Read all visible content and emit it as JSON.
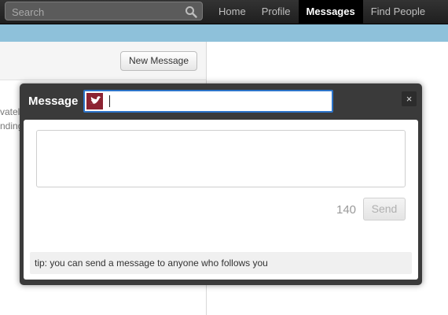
{
  "search": {
    "placeholder": "Search",
    "icon": "magnifier"
  },
  "nav": {
    "items": [
      {
        "label": "Home",
        "active": false
      },
      {
        "label": "Profile",
        "active": false
      },
      {
        "label": "Messages",
        "active": true
      },
      {
        "label": "Find People",
        "active": false
      }
    ]
  },
  "page": {
    "new_message_label": "New Message",
    "partial_line_1": "vately message s",
    "partial_line_2": "nding"
  },
  "modal": {
    "title": "Message",
    "recipient_value": "",
    "message_value": "",
    "char_count": "140",
    "send_label": "Send",
    "close_glyph": "×",
    "tip": "tip: you can send a message to anyone who follows you"
  },
  "colors": {
    "topbar": "#222222",
    "accent_bar": "#8ec1da",
    "modal_bg": "#3a3a3a",
    "focus_border": "#2c74c9",
    "avatar": "#8c2332"
  }
}
